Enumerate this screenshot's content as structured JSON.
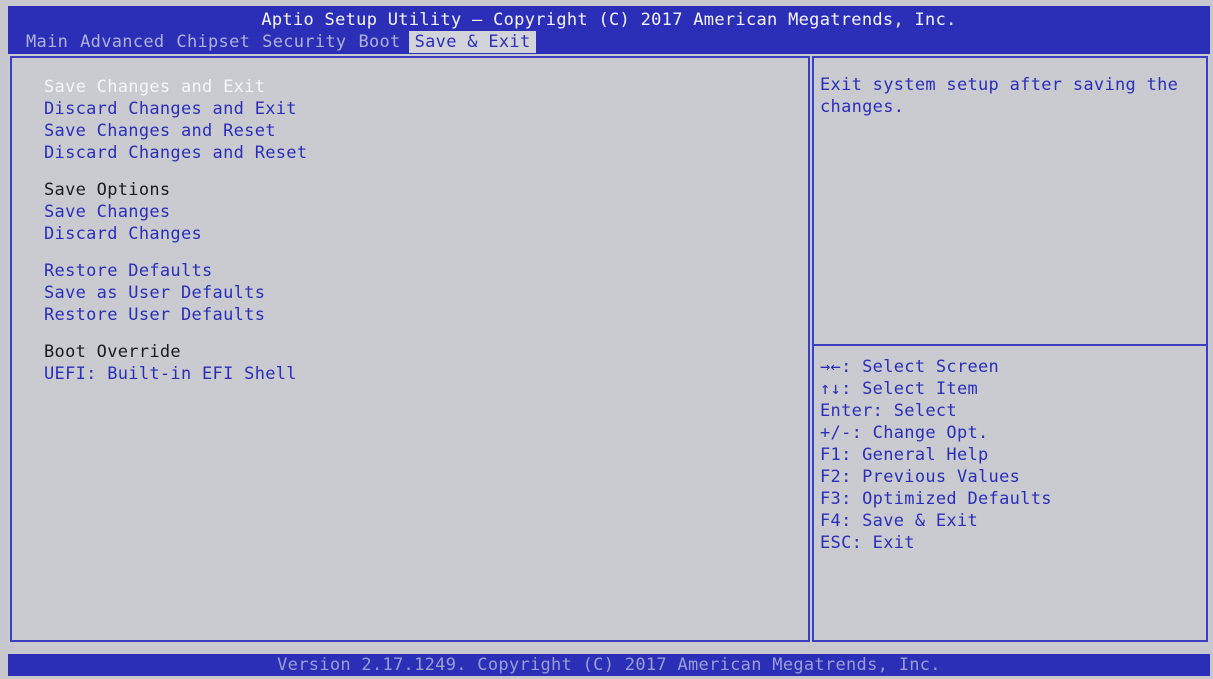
{
  "header": {
    "title": "Aptio Setup Utility – Copyright (C) 2017 American Megatrends, Inc.",
    "tabs": [
      "Main",
      "Advanced",
      "Chipset",
      "Security",
      "Boot",
      "Save & Exit"
    ],
    "active_tab": "Save & Exit"
  },
  "menu": {
    "save_changes_and_exit": "Save Changes and Exit",
    "discard_changes_and_exit": "Discard Changes and Exit",
    "save_changes_and_reset": "Save Changes and Reset",
    "discard_changes_and_reset": "Discard Changes and Reset",
    "save_options_heading": "Save Options",
    "save_changes": "Save Changes",
    "discard_changes": "Discard Changes",
    "restore_defaults": "Restore Defaults",
    "save_as_user_defaults": "Save as User Defaults",
    "restore_user_defaults": "Restore User Defaults",
    "boot_override_heading": "Boot Override",
    "uefi_builtin_efi_shell": "UEFI: Built-in EFI Shell"
  },
  "help": {
    "text": "Exit system setup after saving the changes."
  },
  "keys": [
    "→←: Select Screen",
    "↑↓: Select Item",
    "Enter: Select",
    "+/-: Change Opt.",
    "F1: General Help",
    "F2: Previous Values",
    "F3: Optimized Defaults",
    "F4: Save & Exit",
    "ESC: Exit"
  ],
  "footer": {
    "text": "Version 2.17.1249. Copyright (C) 2017 American Megatrends, Inc."
  },
  "colors": {
    "bar_blue": "#2b2fb8",
    "panel_gray": "#c9cbd1",
    "selected_text": "#f6f6fa",
    "item_text": "#2b2fb8"
  }
}
